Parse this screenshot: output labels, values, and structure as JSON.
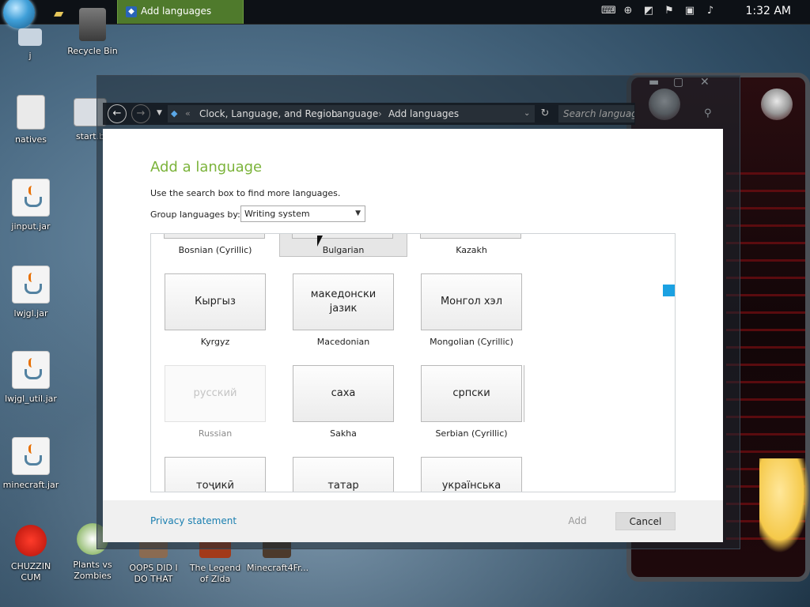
{
  "taskbar": {
    "task_label": "Add languages",
    "clock": "1:32 AM"
  },
  "desktop": {
    "icons": [
      {
        "label": "j"
      },
      {
        "label": "Recycle Bin"
      },
      {
        "label": "natives"
      },
      {
        "label": "start.b"
      },
      {
        "label": "jinput.jar"
      },
      {
        "label": "lwjgl.jar"
      },
      {
        "label": "lwjgl_util.jar"
      },
      {
        "label": "minecraft.jar"
      },
      {
        "label": "CHUZZIN CUM"
      },
      {
        "label": "Plants vs Zombies"
      },
      {
        "label": "OOPS DID I DO THAT"
      },
      {
        "label": "The Legend of Zlda"
      },
      {
        "label": "Minecraft4Fr..."
      }
    ]
  },
  "explorer": {
    "breadcrumb": [
      "Clock, Language, and Region",
      "Language",
      "Add languages"
    ],
    "search_placeholder": "Search languages"
  },
  "dialog": {
    "title": "Add a language",
    "hint": "Use the search box to find more languages.",
    "group_label": "Group languages by:",
    "group_value": "Writing system",
    "languages": [
      {
        "caption": "Bosnian (Cyrillic)",
        "native": ""
      },
      {
        "caption": "Bulgarian",
        "native": ""
      },
      {
        "caption": "Kazakh",
        "native": ""
      },
      {
        "caption": "Kyrgyz",
        "native": "Кыргыз"
      },
      {
        "caption": "Macedonian",
        "native": "македонски јазик"
      },
      {
        "caption": "Mongolian (Cyrillic)",
        "native": "Монгол хэл"
      },
      {
        "caption": "Russian",
        "native": "русский"
      },
      {
        "caption": "Sakha",
        "native": "саха"
      },
      {
        "caption": "Serbian (Cyrillic)",
        "native": "српски"
      },
      {
        "caption": "",
        "native": "тоҷикӣ"
      },
      {
        "caption": "",
        "native": "татар"
      },
      {
        "caption": "",
        "native": "українська"
      }
    ],
    "privacy": "Privacy statement",
    "add_label": "Add",
    "cancel_label": "Cancel"
  },
  "colors": {
    "title_green": "#7bb33a",
    "link_blue": "#1a7fb0",
    "scroll_accent": "#1ba1e2",
    "taskbar_task": "#4f7a2c"
  }
}
